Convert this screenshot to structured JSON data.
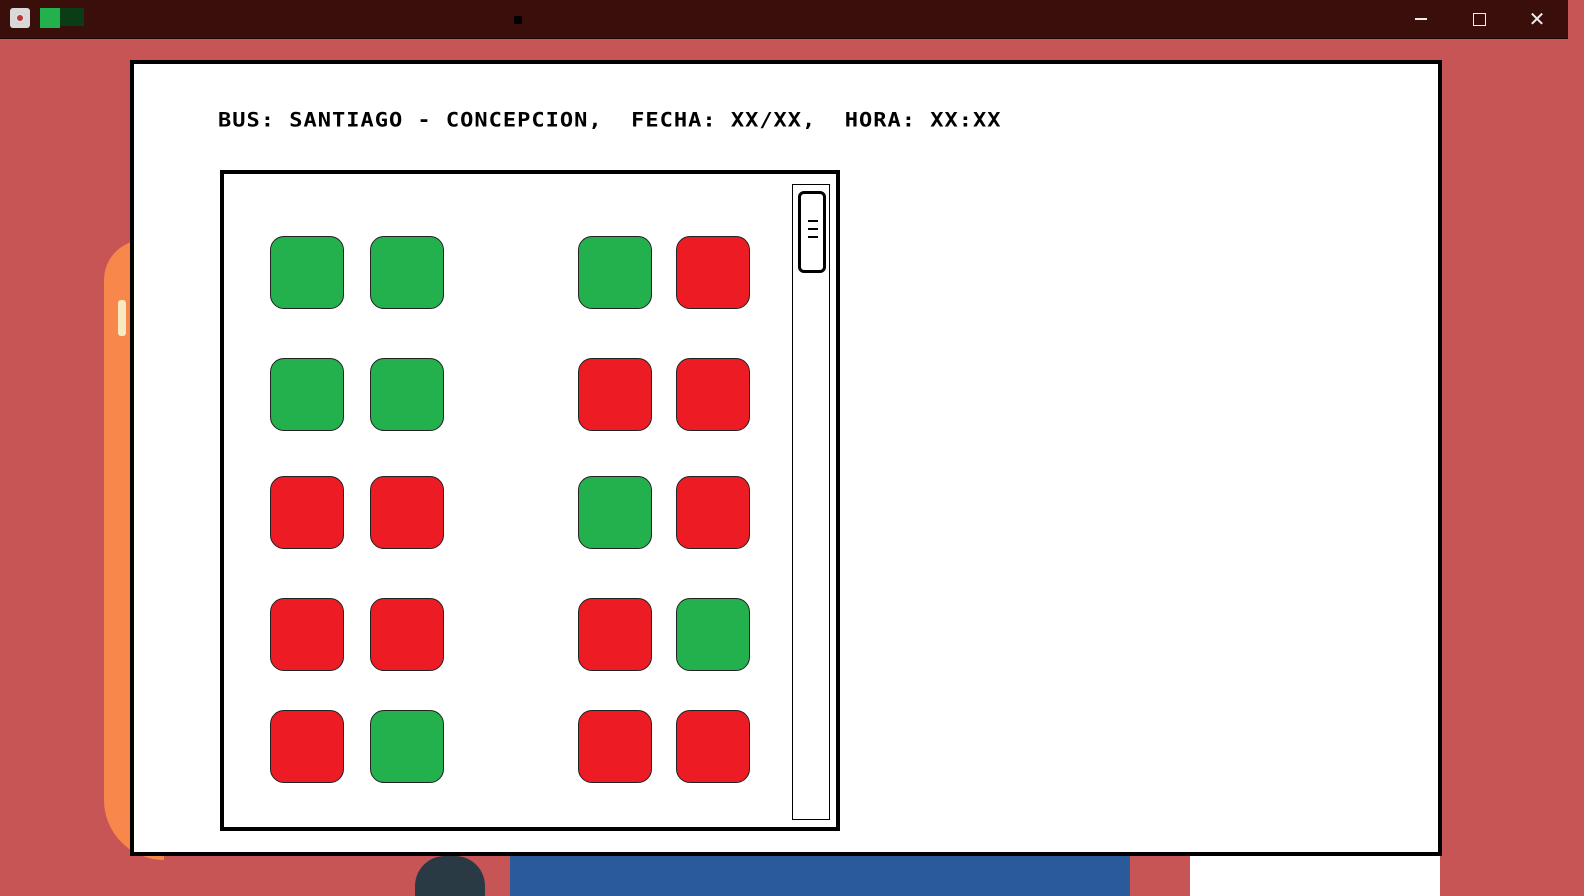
{
  "window": {
    "controls": {
      "minimize_icon": "minimize-icon",
      "maximize_icon": "maximize-icon",
      "close_icon": "close-icon",
      "close_glyph": "✕"
    }
  },
  "header": {
    "text": "BUS: SANTIAGO - CONCEPCION,  FECHA: XX/XX,  HORA: XX:XX"
  },
  "seats": {
    "colors": {
      "free": "#22b14c",
      "taken": "#ed1c24"
    },
    "rows": [
      [
        "free",
        "free",
        "free",
        "taken"
      ],
      [
        "free",
        "free",
        "taken",
        "taken"
      ],
      [
        "taken",
        "taken",
        "free",
        "taken"
      ],
      [
        "taken",
        "taken",
        "taken",
        "free"
      ],
      [
        "taken",
        "free",
        "taken",
        "taken"
      ]
    ]
  }
}
